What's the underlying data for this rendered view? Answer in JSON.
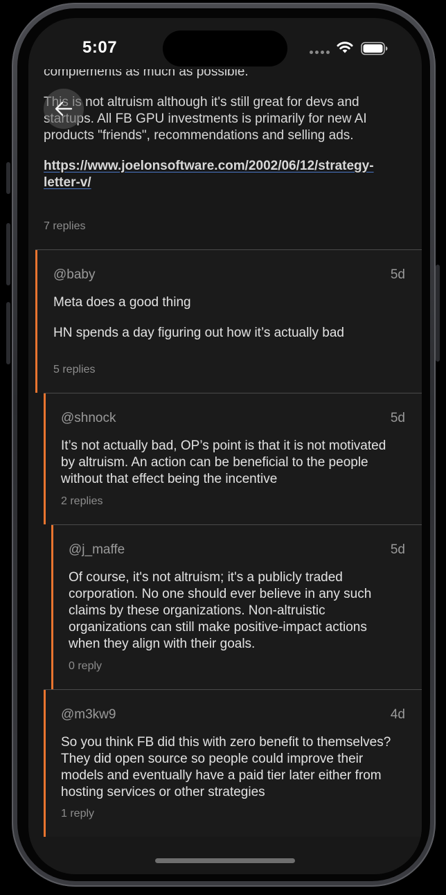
{
  "status_bar": {
    "time": "5:07"
  },
  "post": {
    "clipped_line": "complements as much as possible.",
    "paragraph": "This is not altruism although it's still great for devs and startups. All FB GPU investments is primarily for new AI products \"friends\", recommendations and selling ads.",
    "link": "https://www.joelonsoftware.com/2002/06/12/strategy-letter-v/",
    "replies_label": "7 replies"
  },
  "comments": [
    {
      "user": "@baby",
      "age": "5d",
      "paragraphs": [
        "Meta does a good thing",
        "HN spends a day figuring out how it’s actually bad"
      ],
      "replies_label": "5 replies"
    },
    {
      "user": "@shnock",
      "age": "5d",
      "paragraphs": [
        "It’s not actually bad, OP’s point is that it is not motivated by altruism. An action can be beneficial to the people without that effect being the incentive"
      ],
      "replies_label": "2 replies"
    },
    {
      "user": "@j_maffe",
      "age": "5d",
      "paragraphs": [
        "Of course, it's not altruism; it's a publicly traded corporation. No one should ever believe in any such claims by these organizations. Non-altruistic organizations can still make positive-impact actions when they align with their goals."
      ],
      "replies_label": "0 reply"
    },
    {
      "user": "@m3kw9",
      "age": "4d",
      "paragraphs": [
        "So you think FB did this with zero benefit to themselves? They did open source so people could improve their models and eventually have a paid tier later either from hosting services or other strategies"
      ],
      "replies_label": "1 reply"
    }
  ],
  "colors": {
    "background": "#181818",
    "thread_bar": "#e8742f",
    "link_underline": "#4a78c8",
    "text": "#e2e2e2",
    "muted": "#8d8d8d"
  },
  "icons": {
    "back": "arrow-left-icon",
    "wifi": "wifi-icon",
    "battery": "battery-icon",
    "signal": "signal-dots-icon"
  }
}
